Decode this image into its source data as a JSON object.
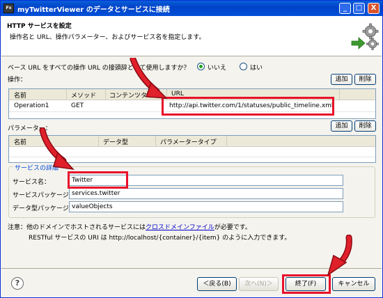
{
  "window": {
    "app_icon_text": "Fx",
    "title": "myTwitterViewer のデータとサービスに接続",
    "minimize": "_",
    "maximize": "□",
    "close": "X"
  },
  "header": {
    "title": "HTTP サービスを設定",
    "description": "操作名と URL、操作パラメーター、およびサービス名を指定します。"
  },
  "base_url": {
    "question": "ベース URL をすべての操作 URL の接頭辞として使用しますか？",
    "option_no": "いいえ",
    "option_yes": "はい",
    "selected": "いいえ"
  },
  "operations": {
    "label": "操作：",
    "add": "追加",
    "delete": "削除",
    "columns": [
      "名前",
      "メソッド",
      "コンテンツタイプ",
      "URL"
    ],
    "rows": [
      {
        "name": "Operation1",
        "method": "GET",
        "content_type": "",
        "url": "http://api.twitter.com/1/statuses/public_timeline.xml"
      }
    ]
  },
  "parameters": {
    "label": "パラメーター：",
    "add": "追加",
    "delete": "削除",
    "columns": [
      "名前",
      "データ型",
      "パラメータータイプ"
    ]
  },
  "service_details": {
    "title": "サービスの詳細",
    "service_name_label": "サービス名：",
    "service_name_value": "Twitter",
    "service_package_label": "サービスパッケージ：",
    "service_package_value": "services.twitter",
    "data_type_package_label": "データ型パッケージ：",
    "data_type_package_value": "valueObjects"
  },
  "note": {
    "prefix": "注意：他のドメインでホストされるサービスには",
    "link": "クロスドメインファイル",
    "suffix": "が必要です。",
    "line2": "RESTful サービスの URI は http://localhost/{container}/{item} のように入力できます。"
  },
  "buttons": {
    "help": "?",
    "back": "＜戻る(B)",
    "next": "次へ(N)＞",
    "finish": "終了(F)",
    "cancel": "キャンセル"
  },
  "colors": {
    "highlight_red": "#E8102B",
    "arrow_red": "#E0202A",
    "title_blue": "#0A5FD8",
    "group_title_blue": "#0046D5"
  }
}
